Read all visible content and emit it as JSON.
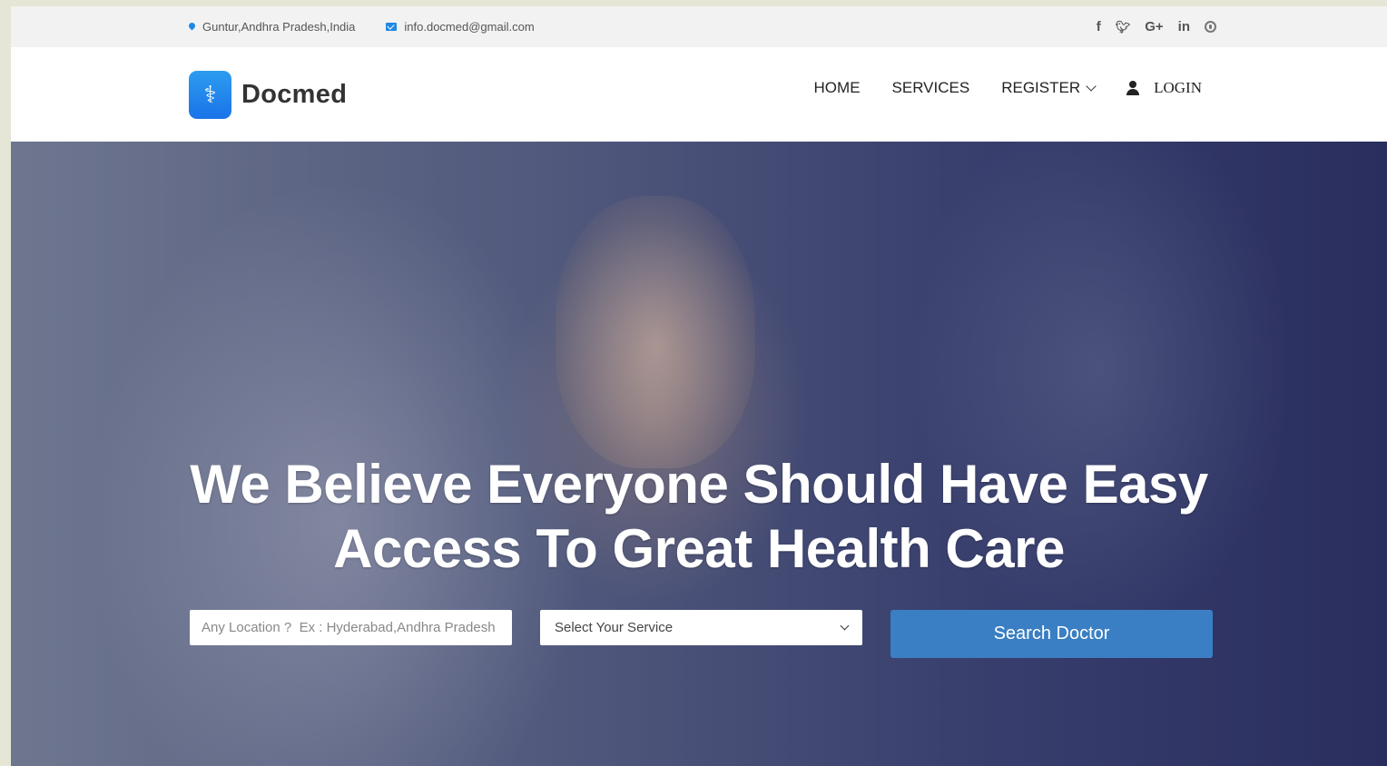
{
  "topbar": {
    "location": "Guntur,Andhra Pradesh,India",
    "email": "info.docmed@gmail.com",
    "social_icons": [
      "facebook-icon",
      "twitter-icon",
      "google-plus-icon",
      "linkedin-icon",
      "pinterest-icon"
    ],
    "social_glyphs": {
      "facebook": "f",
      "twitter": "🐦",
      "google": "G+",
      "linkedin": "in"
    }
  },
  "header": {
    "brand": "Docmed",
    "nav": {
      "home": "HOME",
      "services": "SERVICES",
      "register": "REGISTER",
      "login": "LOGIN"
    }
  },
  "hero": {
    "headline_line1": "We Believe Everyone Should Have Easy",
    "headline_line2": "Access To Great Health Care",
    "location_placeholder": "Any Location ?  Ex : Hyderabad,Andhra Pradesh",
    "service_select": "Select Your Service",
    "search_button": "Search Doctor"
  },
  "colors": {
    "accent": "#1e88e5",
    "button": "#3a7fc3",
    "hero_overlay": "#2b2f5e"
  }
}
